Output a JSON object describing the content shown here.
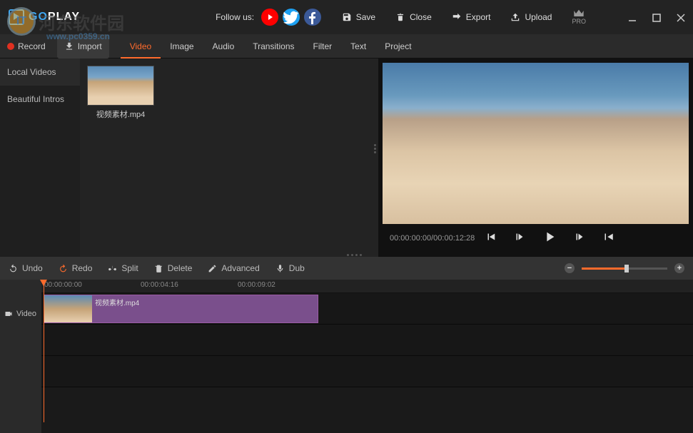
{
  "header": {
    "logo_go": "GO",
    "logo_play": "PLAY",
    "follow_label": "Follow us:",
    "actions": {
      "save": "Save",
      "close": "Close",
      "export": "Export",
      "upload": "Upload"
    },
    "pro_label": "PRO"
  },
  "watermark": {
    "text": "河东软件园",
    "sub": "www.pc0359.cn"
  },
  "toolbar": {
    "record": "Record",
    "import": "Import",
    "tabs": [
      "Video",
      "Image",
      "Audio",
      "Transitions",
      "Filter",
      "Text",
      "Project"
    ]
  },
  "sidebar": {
    "items": [
      "Local Videos",
      "Beautiful Intros"
    ]
  },
  "media": {
    "items": [
      {
        "name": "视频素材.mp4"
      }
    ]
  },
  "preview": {
    "time": "00:00:00:00/00:00:12:28"
  },
  "timeline_tools": {
    "undo": "Undo",
    "redo": "Redo",
    "split": "Split",
    "delete": "Delete",
    "advanced": "Advanced",
    "dub": "Dub"
  },
  "timeline": {
    "track_label": "Video",
    "ruler": [
      "00:00:00:00",
      "00:00:04:16",
      "00:00:09:02"
    ],
    "clip_name": "视频素材.mp4"
  }
}
